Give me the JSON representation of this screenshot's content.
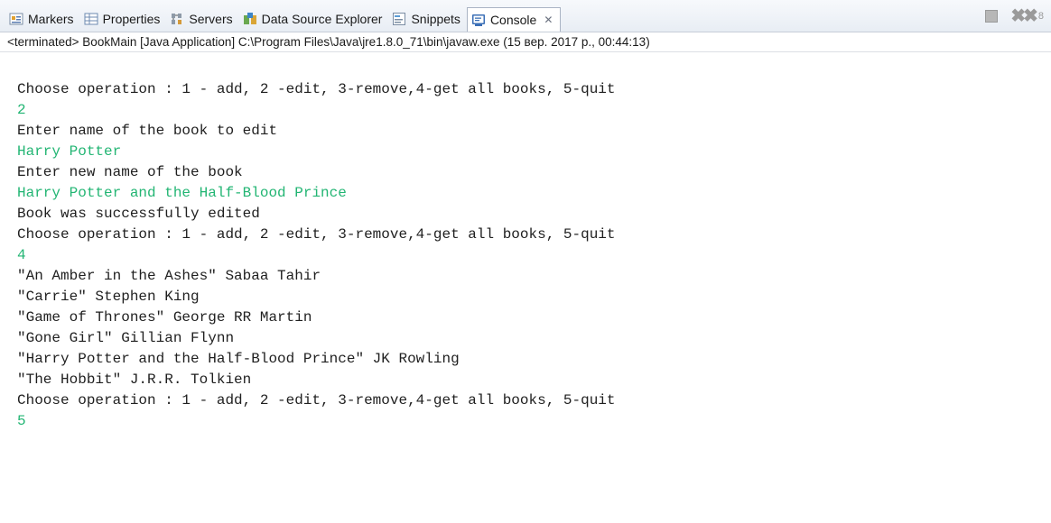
{
  "tabs": [
    {
      "label": "Markers",
      "icon": "markers-icon",
      "active": false
    },
    {
      "label": "Properties",
      "icon": "properties-icon",
      "active": false
    },
    {
      "label": "Servers",
      "icon": "servers-icon",
      "active": false
    },
    {
      "label": "Data Source Explorer",
      "icon": "data-source-explorer-icon",
      "active": false
    },
    {
      "label": "Snippets",
      "icon": "snippets-icon",
      "active": false
    },
    {
      "label": "Console",
      "icon": "console-icon",
      "active": true,
      "close": "✕"
    }
  ],
  "toolbar": {
    "remove_suffix": "8"
  },
  "status_line": "<terminated> BookMain [Java Application] C:\\Program Files\\Java\\jre1.8.0_71\\bin\\javaw.exe (15 вер. 2017 р., 00:44:13)",
  "console": {
    "lines": [
      {
        "text": "Choose operation : 1 - add, 2 -edit, 3-remove,4-get all books, 5-quit",
        "type": "output"
      },
      {
        "text": "2",
        "type": "input"
      },
      {
        "text": "Enter name of the book to edit",
        "type": "output"
      },
      {
        "text": "Harry Potter",
        "type": "input"
      },
      {
        "text": "Enter new name of the book",
        "type": "output"
      },
      {
        "text": "Harry Potter and the Half-Blood Prince",
        "type": "input"
      },
      {
        "text": "Book was successfully edited",
        "type": "output"
      },
      {
        "text": "Choose operation : 1 - add, 2 -edit, 3-remove,4-get all books, 5-quit",
        "type": "output"
      },
      {
        "text": "4",
        "type": "input"
      },
      {
        "text": "\"An Amber in the Ashes\" Sabaa Tahir",
        "type": "output"
      },
      {
        "text": "\"Carrie\" Stephen King",
        "type": "output"
      },
      {
        "text": "\"Game of Thrones\" George RR Martin",
        "type": "output"
      },
      {
        "text": "\"Gone Girl\" Gillian Flynn",
        "type": "output"
      },
      {
        "text": "\"Harry Potter and the Half-Blood Prince\" JK Rowling",
        "type": "output"
      },
      {
        "text": "\"The Hobbit\" J.R.R. Tolkien",
        "type": "output"
      },
      {
        "text": "Choose operation : 1 - add, 2 -edit, 3-remove,4-get all books, 5-quit",
        "type": "output"
      },
      {
        "text": "5",
        "type": "input"
      }
    ]
  },
  "colors": {
    "input_text": "#22b573",
    "output_text": "#1f1f1f",
    "tab_bar_bg": "#e8edf4"
  }
}
